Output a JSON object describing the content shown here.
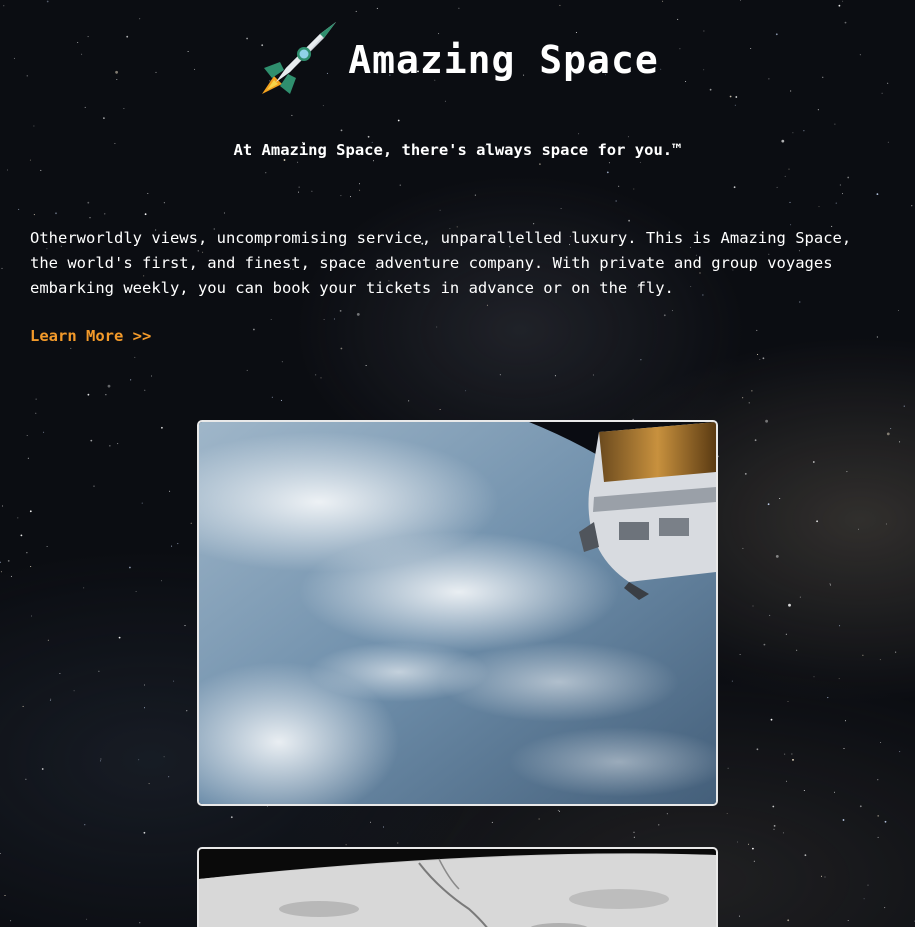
{
  "header": {
    "logo_icon": "rocket-icon",
    "title": "Amazing Space"
  },
  "tagline": "At Amazing Space, there's always space for you.™",
  "intro": {
    "text": "Otherworldly views, uncompromising service, unparallelled luxury. This is Amazing Space, the world's first, and finest, space adventure company. With private and group voyages embarking weekly, you can book your tickets in advance or on the fly."
  },
  "cta": {
    "learn_more": "Learn More >>",
    "color": "#f39a2a"
  },
  "gallery": [
    {
      "subject": "earth-with-space-station"
    },
    {
      "subject": "lunar-surface"
    }
  ]
}
